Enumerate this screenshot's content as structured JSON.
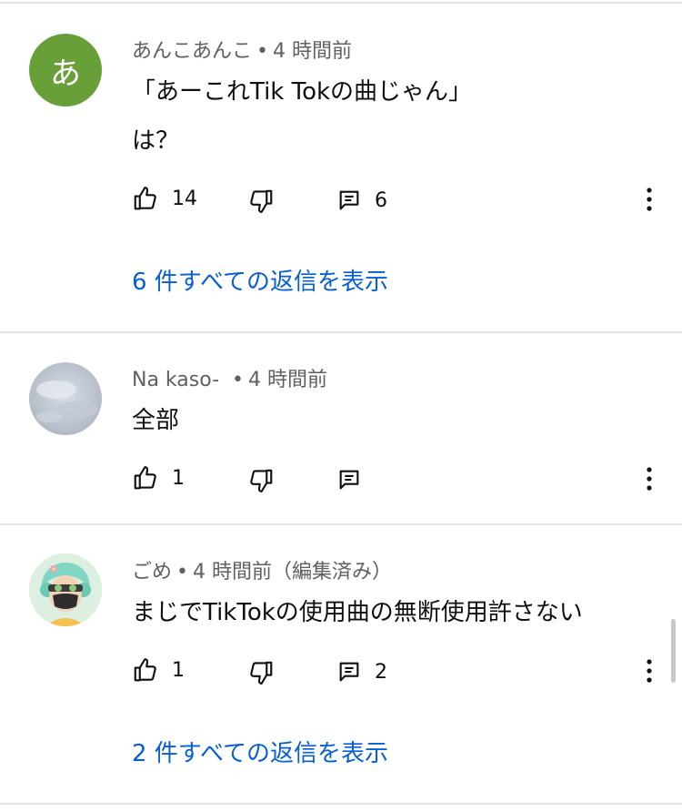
{
  "colors": {
    "meta_text": "#606060",
    "body_text": "#0f0f0f",
    "link_blue": "#065fd4",
    "avatar_green": "#689f38",
    "divider": "#e5e5e5"
  },
  "icons": {
    "like": "thumbs-up-icon",
    "dislike": "thumbs-down-icon",
    "reply": "reply-comment-icon",
    "more": "more-vertical-icon"
  },
  "comments": [
    {
      "author": "あんこあんこ",
      "time": "4 時間前",
      "edited": "",
      "avatar_letter": "あ",
      "lines": [
        "「あーこれTik Tokの曲じゃん」",
        "は？"
      ],
      "likes": "14",
      "replies_count": "6",
      "view_replies": "6 件すべての返信を表示"
    },
    {
      "author": "Na kaso-",
      "time": "4 時間前",
      "edited": "",
      "lines": [
        "全部"
      ],
      "likes": "1",
      "replies_count": ""
    },
    {
      "author": "ごめ",
      "time": "4 時間前",
      "edited": "（編集済み）",
      "lines": [
        "まじでTikTokの使用曲の無断使用許さない"
      ],
      "likes": "1",
      "replies_count": "2",
      "view_replies": "2 件すべての返信を表示"
    }
  ]
}
